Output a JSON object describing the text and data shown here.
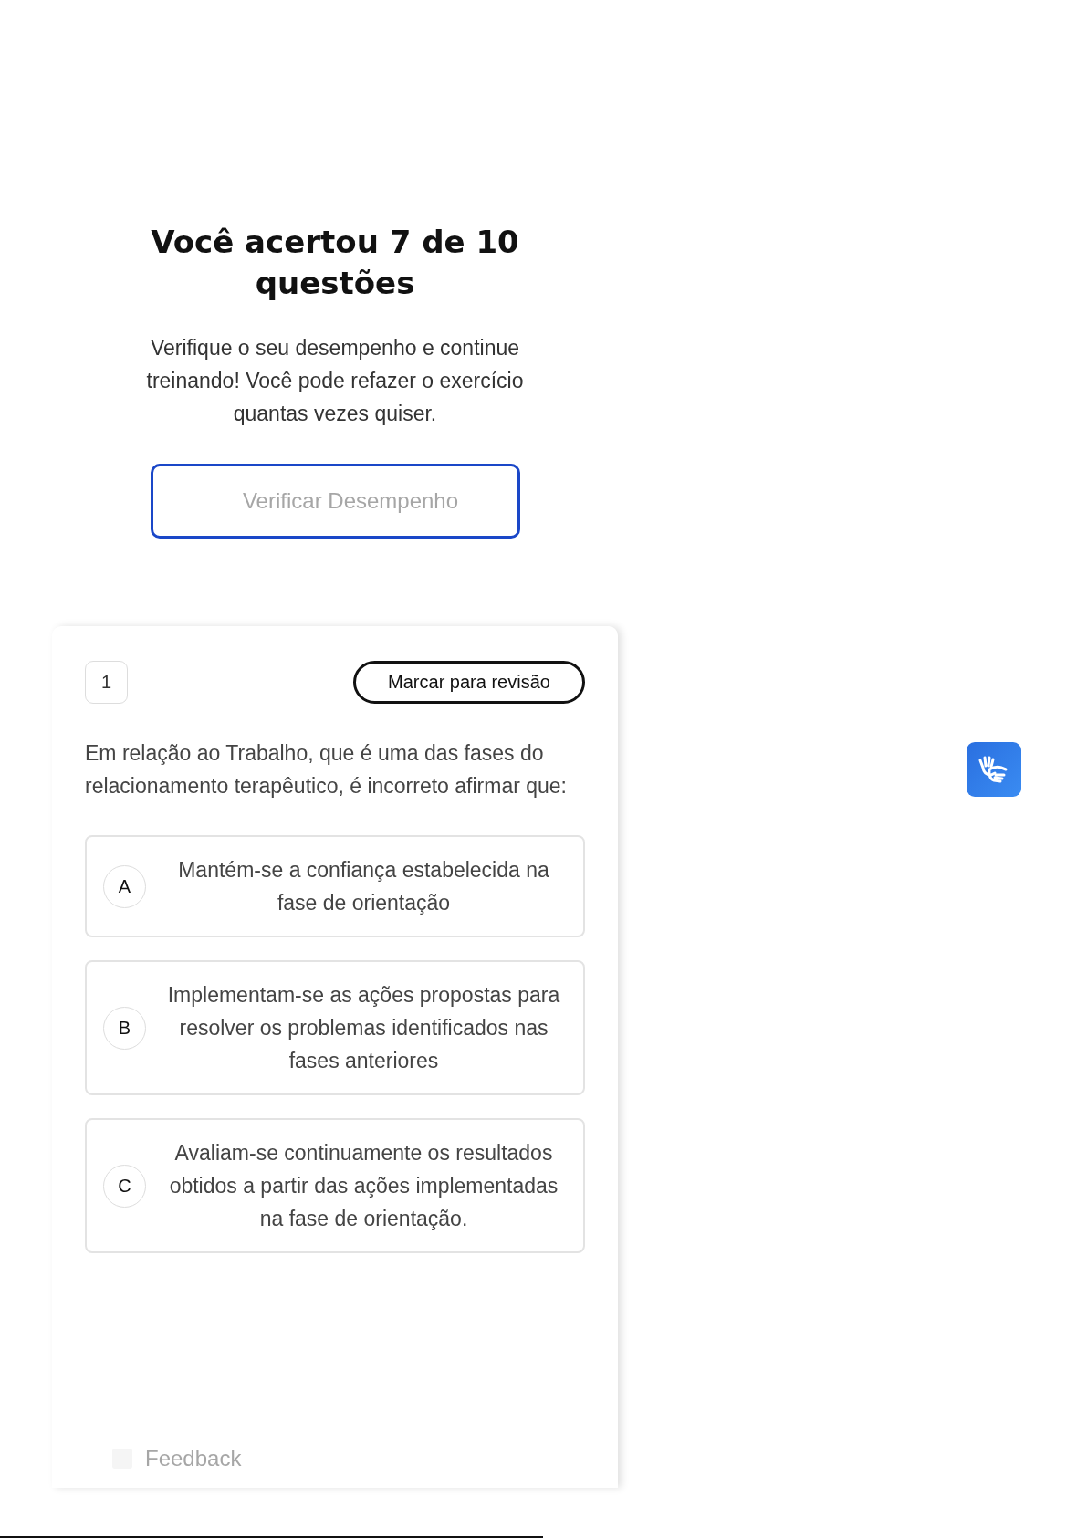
{
  "result": {
    "title": "Você acertou 7 de 10 questões",
    "description": "Verifique o seu desempenho e continue treinando! Você pode refazer o exercício quantas vezes quiser.",
    "button": "Verificar Desempenho"
  },
  "question": {
    "number": "1",
    "review_button": "Marcar para revisão",
    "text": "Em relação ao Trabalho, que é uma das fases do relacionamento terapêutico, é incorreto afirmar que:",
    "options": [
      {
        "letter": "A",
        "text": "Mantém-se a confiança estabelecida na fase de orientação"
      },
      {
        "letter": "B",
        "text": "Implementam-se as ações propostas para resolver os problemas identificados nas fases anteriores"
      },
      {
        "letter": "C",
        "text": "Avaliam-se continuamente os resultados obtidos a partir das ações implementadas na fase de orientação."
      }
    ]
  },
  "feedback": {
    "label": "Feedback"
  }
}
